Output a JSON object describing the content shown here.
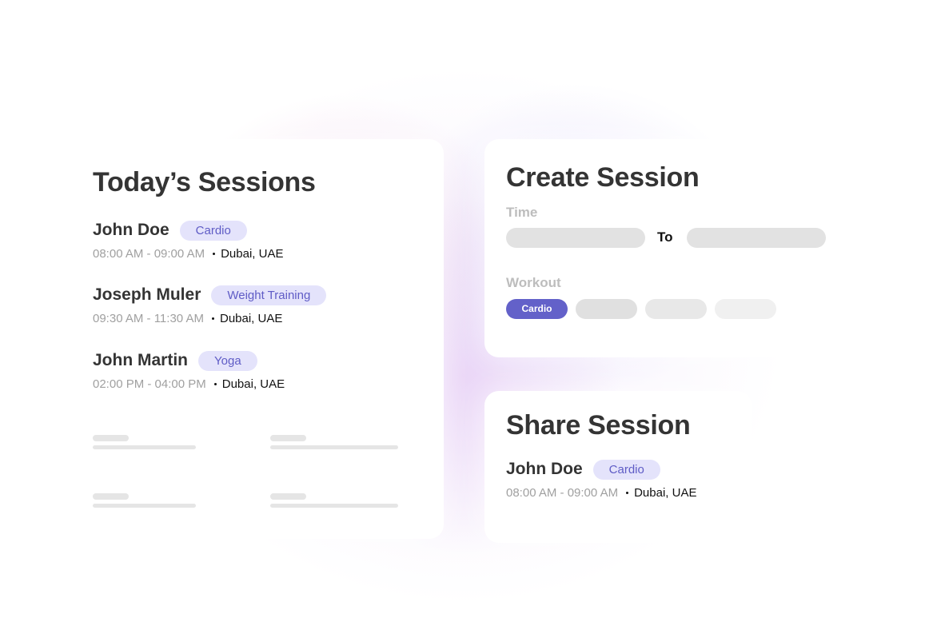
{
  "todays_sessions": {
    "title": "Today’s Sessions",
    "sessions": [
      {
        "name": "John Doe",
        "workout": "Cardio",
        "time": "08:00 AM - 09:00 AM",
        "location": "Dubai, UAE"
      },
      {
        "name": "Joseph Muler",
        "workout": "Weight Training",
        "time": "09:30 AM - 11:30 AM",
        "location": "Dubai, UAE"
      },
      {
        "name": "John Martin",
        "workout": "Yoga",
        "time": "02:00 PM - 04:00 PM",
        "location": "Dubai, UAE"
      }
    ]
  },
  "create_session": {
    "title": "Create Session",
    "time_label": "Time",
    "to_label": "To",
    "workout_label": "Workout",
    "workout_chips": [
      {
        "label": "Cardio",
        "selected": true
      },
      {
        "label": "",
        "selected": false
      },
      {
        "label": "",
        "selected": false
      },
      {
        "label": "",
        "selected": false
      }
    ]
  },
  "share_session": {
    "title": "Share Session",
    "session": {
      "name": "John Doe",
      "workout": "Cardio",
      "time": "08:00 AM - 09:00 AM",
      "location": "Dubai, UAE"
    }
  },
  "colors": {
    "accent": "#6361c9",
    "badge_bg": "#e4e3fb",
    "badge_text": "#5f5cc6",
    "title_text": "#343434",
    "muted_text": "#a0a0a0"
  }
}
